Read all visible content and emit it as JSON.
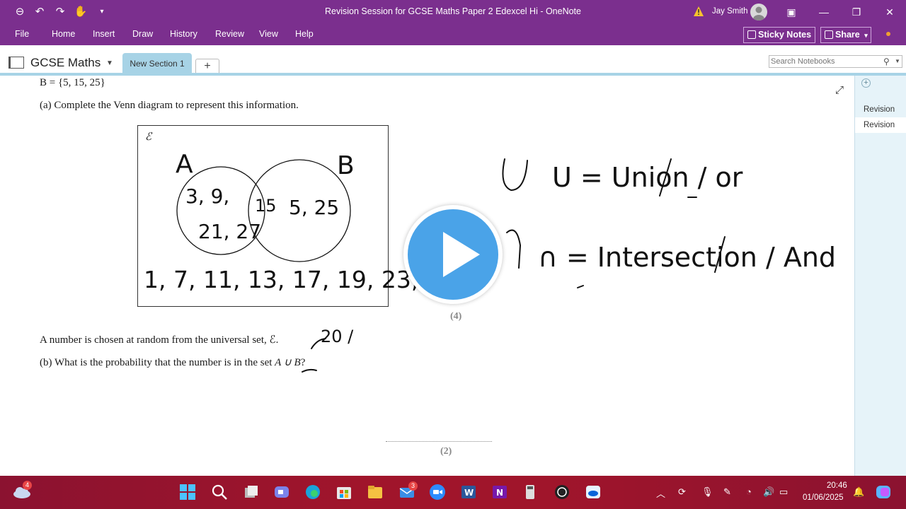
{
  "window": {
    "title": "Revision Session for GCSE Maths Paper 2 Edexcel Hi  -  OneNote",
    "user_name": "Jay Smith"
  },
  "menu": {
    "items": [
      "File",
      "Home",
      "Insert",
      "Draw",
      "History",
      "Review",
      "View",
      "Help"
    ],
    "sticky_notes": "Sticky Notes",
    "share": "Share"
  },
  "notebook": {
    "name": "GCSE Maths",
    "section_tab": "New Section 1",
    "add_tab": "+"
  },
  "search": {
    "placeholder": "Search Notebooks"
  },
  "pages": [
    "Revision",
    "Revision"
  ],
  "question": {
    "set_b": "B = {5, 15, 25}",
    "part_a": "(a)  Complete the Venn diagram to represent this information.",
    "marks_a": "(4)",
    "chosen": "A number is chosen at random from the universal set, ℰ.",
    "part_b_prefix": "(b)  What is the probability that the number is in the set ",
    "part_b_set": "A ∪ B",
    "part_b_suffix": "?",
    "marks_b": "(2)"
  },
  "venn": {
    "universal_symbol": "ℰ",
    "label_a": "A",
    "label_b": "B",
    "a_only": [
      "3, 9,",
      "21, 27"
    ],
    "intersection": "15",
    "b_only": "5, 25",
    "outside": "1, 7, 11, 13, 17, 19, 23, 29"
  },
  "handwriting": {
    "union_note": "U = Union / or",
    "intersection_note": "∩ = Intersection / And",
    "count_note": "20 /"
  },
  "taskbar": {
    "weather_badge": "4",
    "mail_badge": "3",
    "time": "20:46",
    "date": "01/06/2025"
  },
  "colors": {
    "accent": "#7b2f8e",
    "section_tab": "#a7d3e6",
    "play_button": "#4aa3e8",
    "taskbar": "#a0152b"
  }
}
